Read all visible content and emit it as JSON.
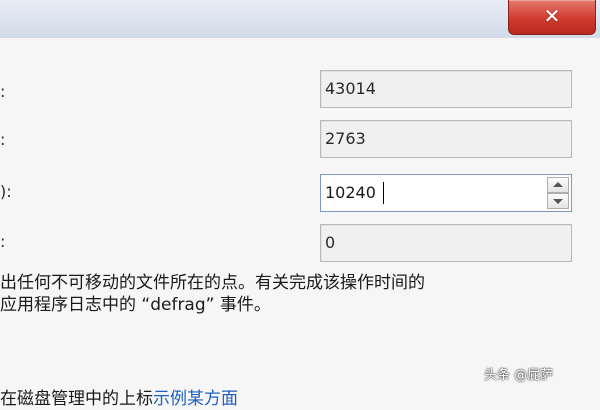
{
  "window": {
    "close_glyph": "✕"
  },
  "fields": {
    "total_value": "43014",
    "second_value": "2763",
    "spinner_value": "10240",
    "fourth_value": "0",
    "labels": {
      "row1_cut": ":",
      "row2_cut": ":",
      "row3_cut": "):",
      "row4_cut": ":"
    }
  },
  "description": {
    "line1": "出任何不可移动的文件所在的点。有关完成该操作时间的",
    "line2": "应用程序日志中的 “defrag” 事件。"
  },
  "bottom": {
    "text": "在磁盘管理中的上标",
    "link": "示例某方面"
  },
  "watermark": {
    "text": "头条 @屁萨"
  },
  "colors": {
    "close_button": "#cf3b2e",
    "link": "#1f5fbf",
    "spinner_border": "#7a98c3"
  }
}
